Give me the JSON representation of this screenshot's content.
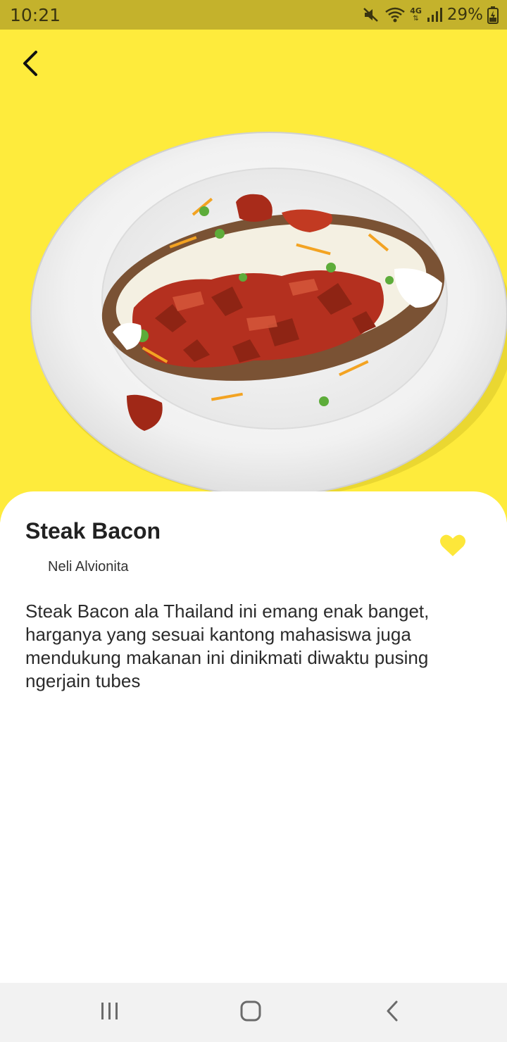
{
  "status_bar": {
    "time": "10:21",
    "network": "4G",
    "battery": "29%",
    "icons": [
      "mute-icon",
      "wifi-icon",
      "network-4g-icon",
      "signal-icon",
      "battery-charging-icon"
    ]
  },
  "hero": {
    "background_color": "#feeb3c",
    "back_icon": "back-arrow-icon",
    "image": "baked-potato-with-pulled-bacon-on-plate"
  },
  "recipe": {
    "title": "Steak Bacon",
    "author": "Neli Alvionita",
    "description": "Steak Bacon ala Thailand ini emang enak banget, harganya yang sesuai kantong mahasiswa juga mendukung makanan ini dinikmati diwaktu pusing ngerjain tubes",
    "favorite_icon": "heart-icon",
    "favorite_color": "#fde73a"
  },
  "nav_bar": {
    "buttons": [
      "recents-icon",
      "home-icon",
      "back-icon"
    ]
  }
}
